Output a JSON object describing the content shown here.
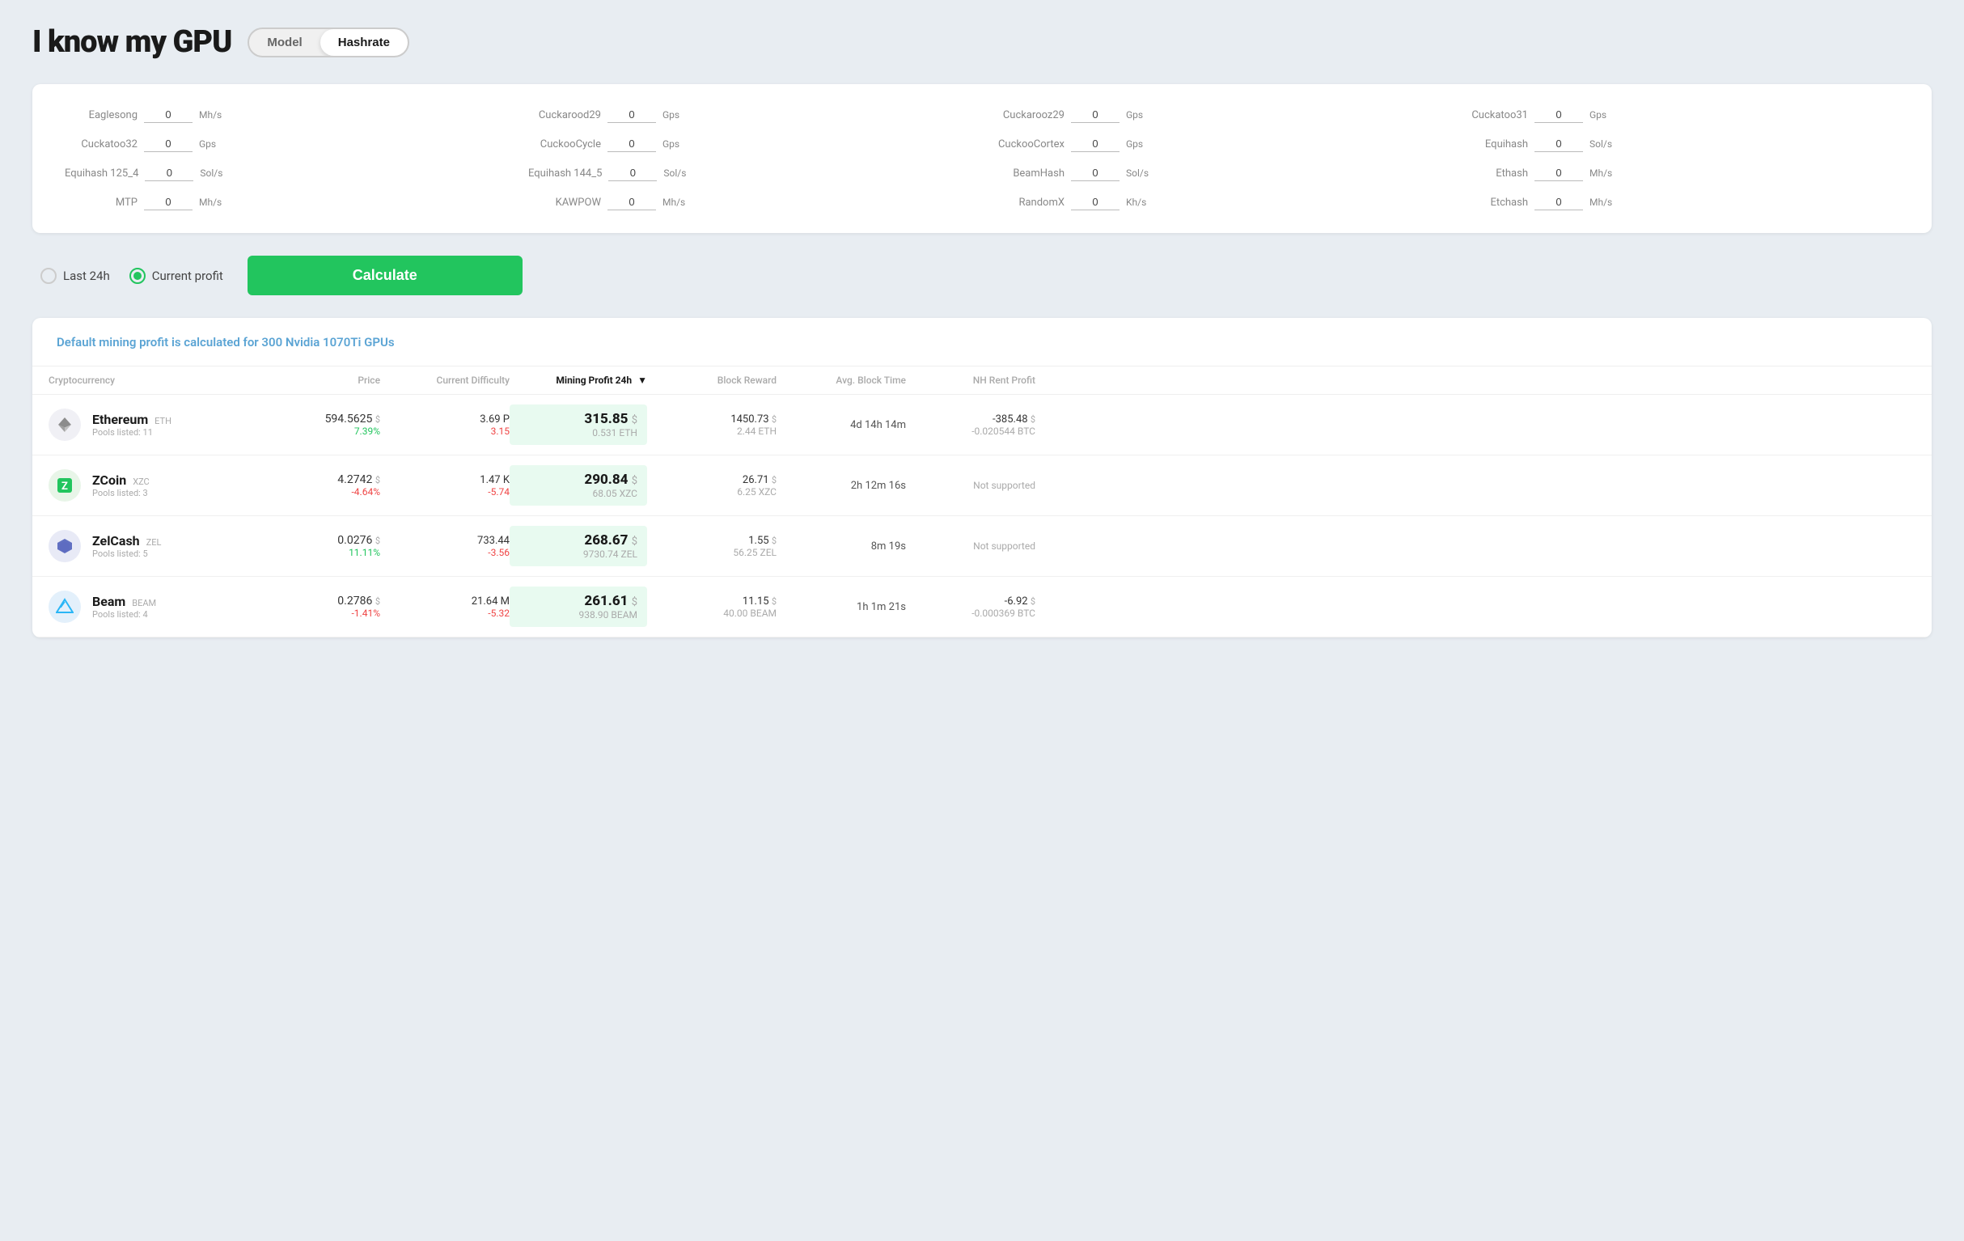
{
  "header": {
    "title": "I know my GPU",
    "toggle": {
      "model_label": "Model",
      "hashrate_label": "Hashrate",
      "active": "Hashrate"
    }
  },
  "hashrate_panel": {
    "fields": [
      {
        "label": "Eaglesong",
        "value": "0",
        "unit": "Mh/s"
      },
      {
        "label": "Cuckarood29",
        "value": "0",
        "unit": "Gps"
      },
      {
        "label": "Cuckarooz29",
        "value": "0",
        "unit": "Gps"
      },
      {
        "label": "Cuckatoo31",
        "value": "0",
        "unit": "Gps"
      },
      {
        "label": "Cuckatoo32",
        "value": "0",
        "unit": "Gps"
      },
      {
        "label": "CuckooCycle",
        "value": "0",
        "unit": "Gps"
      },
      {
        "label": "CuckooCortex",
        "value": "0",
        "unit": "Gps"
      },
      {
        "label": "Equihash",
        "value": "0",
        "unit": "Sol/s"
      },
      {
        "label": "Equihash 125_4",
        "value": "0",
        "unit": "Sol/s"
      },
      {
        "label": "Equihash 144_5",
        "value": "0",
        "unit": "Sol/s"
      },
      {
        "label": "BeamHash",
        "value": "0",
        "unit": "Sol/s"
      },
      {
        "label": "Ethash",
        "value": "0",
        "unit": "Mh/s"
      },
      {
        "label": "MTP",
        "value": "0",
        "unit": "Mh/s"
      },
      {
        "label": "KAWPOW",
        "value": "0",
        "unit": "Mh/s"
      },
      {
        "label": "RandomX",
        "value": "0",
        "unit": "Kh/s"
      },
      {
        "label": "Etchash",
        "value": "0",
        "unit": "Mh/s"
      }
    ]
  },
  "controls": {
    "last24h_label": "Last 24h",
    "current_profit_label": "Current profit",
    "selected": "current_profit",
    "calculate_label": "Calculate"
  },
  "results": {
    "info_text": "Default mining profit is calculated for 300 Nvidia 1070Ti GPUs",
    "table": {
      "headers": [
        {
          "label": "Cryptocurrency",
          "sorted": false
        },
        {
          "label": "Price",
          "sorted": false
        },
        {
          "label": "Current Difficulty",
          "sorted": false
        },
        {
          "label": "Mining Profit 24h",
          "sorted": true
        },
        {
          "label": "Block Reward",
          "sorted": false
        },
        {
          "label": "Avg. Block Time",
          "sorted": false
        },
        {
          "label": "NH Rent Profit",
          "sorted": false
        }
      ],
      "rows": [
        {
          "coin": "Ethereum",
          "ticker": "ETH",
          "pools": "Pools listed: 11",
          "icon_type": "eth",
          "icon_symbol": "◆",
          "price_main": "594.5625",
          "price_currency": "$",
          "price_change": "7.39%",
          "price_change_dir": "up",
          "difficulty_main": "3.69 P",
          "difficulty_change": "3.15",
          "difficulty_change_dir": "down",
          "profit_main": "315.85",
          "profit_currency": "$",
          "profit_sub": "0.531 ETH",
          "block_reward_main": "1450.73",
          "block_reward_currency": "$",
          "block_reward_sub": "2.44 ETH",
          "block_time": "4d 14h 14m",
          "nh_rent_main": "-385.48",
          "nh_rent_currency": "$",
          "nh_rent_sub": "-0.020544 BTC",
          "nh_supported": true
        },
        {
          "coin": "ZCoin",
          "ticker": "XZC",
          "pools": "Pools listed: 3",
          "icon_type": "xcz",
          "icon_symbol": "Z",
          "price_main": "4.2742",
          "price_currency": "$",
          "price_change": "-4.64%",
          "price_change_dir": "down",
          "difficulty_main": "1.47 K",
          "difficulty_change": "-5.74",
          "difficulty_change_dir": "down",
          "profit_main": "290.84",
          "profit_currency": "$",
          "profit_sub": "68.05 XZC",
          "block_reward_main": "26.71",
          "block_reward_currency": "$",
          "block_reward_sub": "6.25 XZC",
          "block_time": "2h 12m 16s",
          "nh_supported": false,
          "nh_not_supported_label": "Not supported"
        },
        {
          "coin": "ZelCash",
          "ticker": "ZEL",
          "pools": "Pools listed: 5",
          "icon_type": "zel",
          "icon_symbol": "⬡",
          "price_main": "0.0276",
          "price_currency": "$",
          "price_change": "11.11%",
          "price_change_dir": "up",
          "difficulty_main": "733.44",
          "difficulty_change": "-3.56",
          "difficulty_change_dir": "down",
          "profit_main": "268.67",
          "profit_currency": "$",
          "profit_sub": "9730.74 ZEL",
          "block_reward_main": "1.55",
          "block_reward_currency": "$",
          "block_reward_sub": "56.25 ZEL",
          "block_time": "8m 19s",
          "nh_supported": false,
          "nh_not_supported_label": "Not supported"
        },
        {
          "coin": "Beam",
          "ticker": "BEAM",
          "pools": "Pools listed: 4",
          "icon_type": "beam",
          "icon_symbol": "▲",
          "price_main": "0.2786",
          "price_currency": "$",
          "price_change": "-1.41%",
          "price_change_dir": "down",
          "difficulty_main": "21.64 M",
          "difficulty_change": "-5.32",
          "difficulty_change_dir": "down",
          "profit_main": "261.61",
          "profit_currency": "$",
          "profit_sub": "938.90 BEAM",
          "block_reward_main": "11.15",
          "block_reward_currency": "$",
          "block_reward_sub": "40.00 BEAM",
          "block_time": "1h 1m 21s",
          "nh_rent_main": "-6.92",
          "nh_rent_currency": "$",
          "nh_rent_sub": "-0.000369 BTC",
          "nh_supported": true
        }
      ]
    }
  }
}
